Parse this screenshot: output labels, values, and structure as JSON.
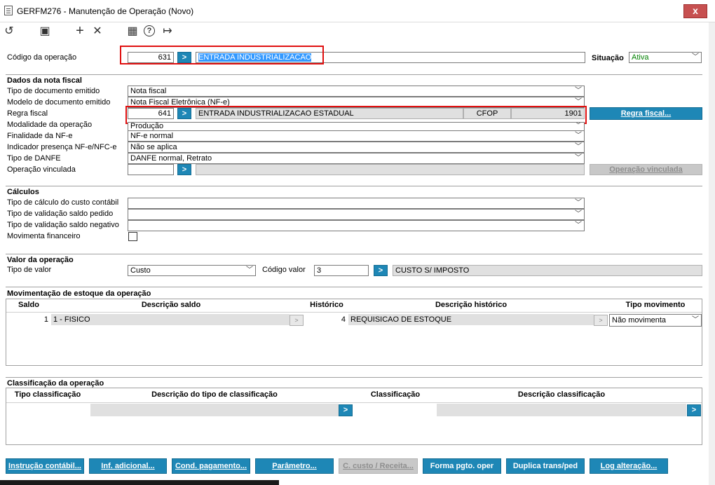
{
  "window": {
    "title": "GERFM276 - Manutenção de Operação (Novo)",
    "close": "x"
  },
  "toolbar": {
    "icons": [
      "undo-icon",
      "save-icon",
      "add-icon",
      "delete-icon",
      "calendar-icon",
      "help-icon",
      "exit-icon"
    ],
    "glyphs": {
      "undo": "↺",
      "save": "▣",
      "add": "+",
      "delete": "✕",
      "calendar": "▦",
      "help": "?",
      "exit": "↦"
    }
  },
  "header": {
    "codigo_label": "Código da operação",
    "codigo_value": "631",
    "codigo_desc": "ENTRADA INDUSTRIALIZACAO",
    "situacao_label": "Situação",
    "situacao_value": "Ativa"
  },
  "nota_fiscal": {
    "section": "Dados da nota fiscal",
    "tipo_doc_label": "Tipo de documento emitido",
    "tipo_doc_value": "Nota fiscal",
    "modelo_label": "Modelo de documento emitido",
    "modelo_value": "Nota Fiscal Eletrônica (NF-e)",
    "regra_label": "Regra fiscal",
    "regra_code": "641",
    "regra_desc": "ENTRADA INDUSTRIALIZACAO ESTADUAL",
    "cfop_label": "CFOP",
    "cfop_value": "1901",
    "regra_button": "Regra fiscal...",
    "modalidade_label": "Modalidade da operação",
    "modalidade_value": "Produção",
    "finalidade_label": "Finalidade da NF-e",
    "finalidade_value": "NF-e normal",
    "indicador_label": "Indicador presença NF-e/NFC-e",
    "indicador_value": "Não se aplica",
    "danfe_label": "Tipo de DANFE",
    "danfe_value": "DANFE normal, Retrato",
    "vinculada_label": "Operação vinculada",
    "vinculada_value": "",
    "vinculada_button": "Operação vinculada"
  },
  "calculos": {
    "section": "Cálculos",
    "custo_label": "Tipo de cálculo do custo contábil",
    "custo_value": "",
    "pedido_label": "Tipo de validação saldo pedido",
    "pedido_value": "",
    "negativo_label": "Tipo de validação saldo negativo",
    "negativo_value": "",
    "financeiro_label": "Movimenta financeiro",
    "financeiro_checked": false
  },
  "valor": {
    "section": "Valor da operação",
    "tipo_label": "Tipo de valor",
    "tipo_value": "Custo",
    "codigo_label": "Código valor",
    "codigo_value": "3",
    "codigo_desc": "CUSTO S/ IMPOSTO"
  },
  "estoque": {
    "section": "Movimentação de estoque da operação",
    "columns": [
      "Saldo",
      "Descrição saldo",
      "Histórico",
      "Descrição histórico",
      "Tipo movimento"
    ],
    "rows": [
      {
        "saldo": "1",
        "descricao_saldo": "1 - FISICO",
        "historico": "4",
        "descricao_historico": "REQUISICAO DE ESTOQUE",
        "tipo_movimento": "Não movimenta"
      }
    ]
  },
  "classificacao": {
    "section": "Classificação da operação",
    "columns": [
      "Tipo classificação",
      "Descrição do tipo de classificação",
      "Classificação",
      "Descrição classificação"
    ]
  },
  "buttons": {
    "instrucao": "Instrução contábil...",
    "inf": "Inf. adicional...",
    "cond": "Cond. pagamento...",
    "parametro": "Parâmetro...",
    "ccusto": "C. custo / Receita...",
    "forma": "Forma pgto. oper",
    "duplica": "Duplica trans/ped",
    "log": "Log alteração..."
  },
  "colors": {
    "accent": "#1e87b6",
    "highlight": "#e01010",
    "status_green": "#008000",
    "selection": "#3399ff"
  }
}
